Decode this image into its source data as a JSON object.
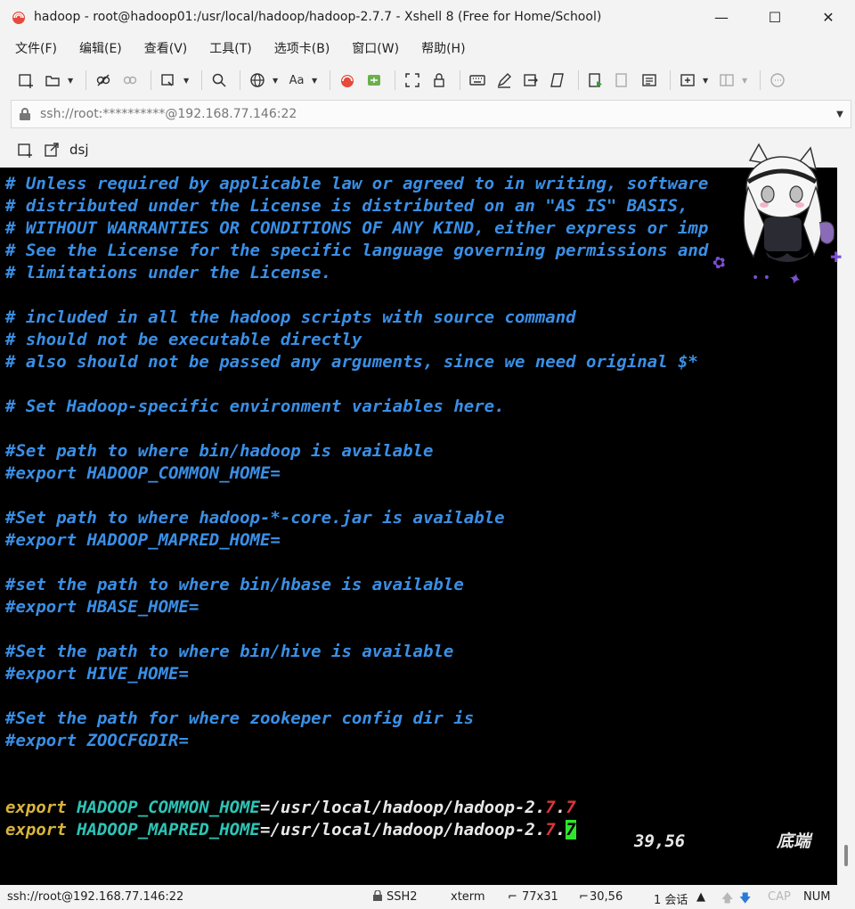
{
  "window": {
    "title": "hadoop - root@hadoop01:/usr/local/hadoop/hadoop-2.7.7 - Xshell 8 (Free for Home/School)",
    "minimize": "—",
    "maximize": "☐",
    "close": "✕"
  },
  "menu": [
    "文件(F)",
    "编辑(E)",
    "查看(V)",
    "工具(T)",
    "选项卡(B)",
    "窗口(W)",
    "帮助(H)"
  ],
  "toolbar": {
    "font_label": "Aa"
  },
  "address": {
    "text": "ssh://root:**********@192.168.77.146:22"
  },
  "tab": {
    "label": "dsj"
  },
  "terminal": {
    "lines": [
      [
        {
          "t": "# Unless required by applicable law or agreed to in writing, software",
          "c": "comment"
        }
      ],
      [
        {
          "t": "# distributed under the License is distributed on an \"AS IS\" BASIS,",
          "c": "comment"
        }
      ],
      [
        {
          "t": "# WITHOUT WARRANTIES OR CONDITIONS OF ANY KIND, either express or imp",
          "c": "comment"
        }
      ],
      [
        {
          "t": "# See the License for the specific language governing permissions and",
          "c": "comment"
        }
      ],
      [
        {
          "t": "# limitations under the License.",
          "c": "comment"
        }
      ],
      [],
      [
        {
          "t": "# included in all the hadoop scripts with source command",
          "c": "comment"
        }
      ],
      [
        {
          "t": "# should not be executable directly",
          "c": "comment"
        }
      ],
      [
        {
          "t": "# also should not be passed any arguments, since we need original $*",
          "c": "comment"
        }
      ],
      [],
      [
        {
          "t": "# Set Hadoop-specific environment variables here.",
          "c": "comment"
        }
      ],
      [],
      [
        {
          "t": "#Set path to where bin/hadoop is available",
          "c": "comment"
        }
      ],
      [
        {
          "t": "#export HADOOP_COMMON_HOME=",
          "c": "comment"
        }
      ],
      [],
      [
        {
          "t": "#Set path to where hadoop-*-core.jar is available",
          "c": "comment"
        }
      ],
      [
        {
          "t": "#export HADOOP_MAPRED_HOME=",
          "c": "comment"
        }
      ],
      [],
      [
        {
          "t": "#set the path to where bin/hbase is available",
          "c": "comment"
        }
      ],
      [
        {
          "t": "#export HBASE_HOME=",
          "c": "comment"
        }
      ],
      [],
      [
        {
          "t": "#Set the path to where bin/hive is available",
          "c": "comment"
        }
      ],
      [
        {
          "t": "#export HIVE_HOME=",
          "c": "comment"
        }
      ],
      [],
      [
        {
          "t": "#Set the path for where zookeper config dir is",
          "c": "comment"
        }
      ],
      [
        {
          "t": "#export ZOOCFGDIR=",
          "c": "comment"
        }
      ],
      [],
      [],
      [
        {
          "t": "export",
          "c": "kw"
        },
        {
          "t": " ",
          "c": "path"
        },
        {
          "t": "HADOOP_COMMON_HOME",
          "c": "var"
        },
        {
          "t": "=/usr/local/hadoop/hadoop-2.",
          "c": "path"
        },
        {
          "t": "7",
          "c": "red"
        },
        {
          "t": ".",
          "c": "path"
        },
        {
          "t": "7",
          "c": "red"
        }
      ],
      [
        {
          "t": "export",
          "c": "kw"
        },
        {
          "t": " ",
          "c": "path"
        },
        {
          "t": "HADOOP_MAPRED_HOME",
          "c": "var"
        },
        {
          "t": "=/usr/local/hadoop/hadoop-2.",
          "c": "path"
        },
        {
          "t": "7",
          "c": "red"
        },
        {
          "t": ".",
          "c": "path"
        },
        {
          "t": "7",
          "c": "cursor"
        }
      ]
    ],
    "position": "39,56",
    "position_label": "底端"
  },
  "statusbar": {
    "connection": "ssh://root@192.168.77.146:22",
    "protocol": "SSH2",
    "terminal_type": "xterm",
    "size": "77x31",
    "cursor": "30,56",
    "sessions": "1 会话",
    "caps": "CAP",
    "num": "NUM"
  },
  "colors": {
    "comment": "#3a8fe6",
    "keyword": "#d9b33b",
    "variable": "#2ec4b6",
    "cursor": "#2ee62e"
  }
}
